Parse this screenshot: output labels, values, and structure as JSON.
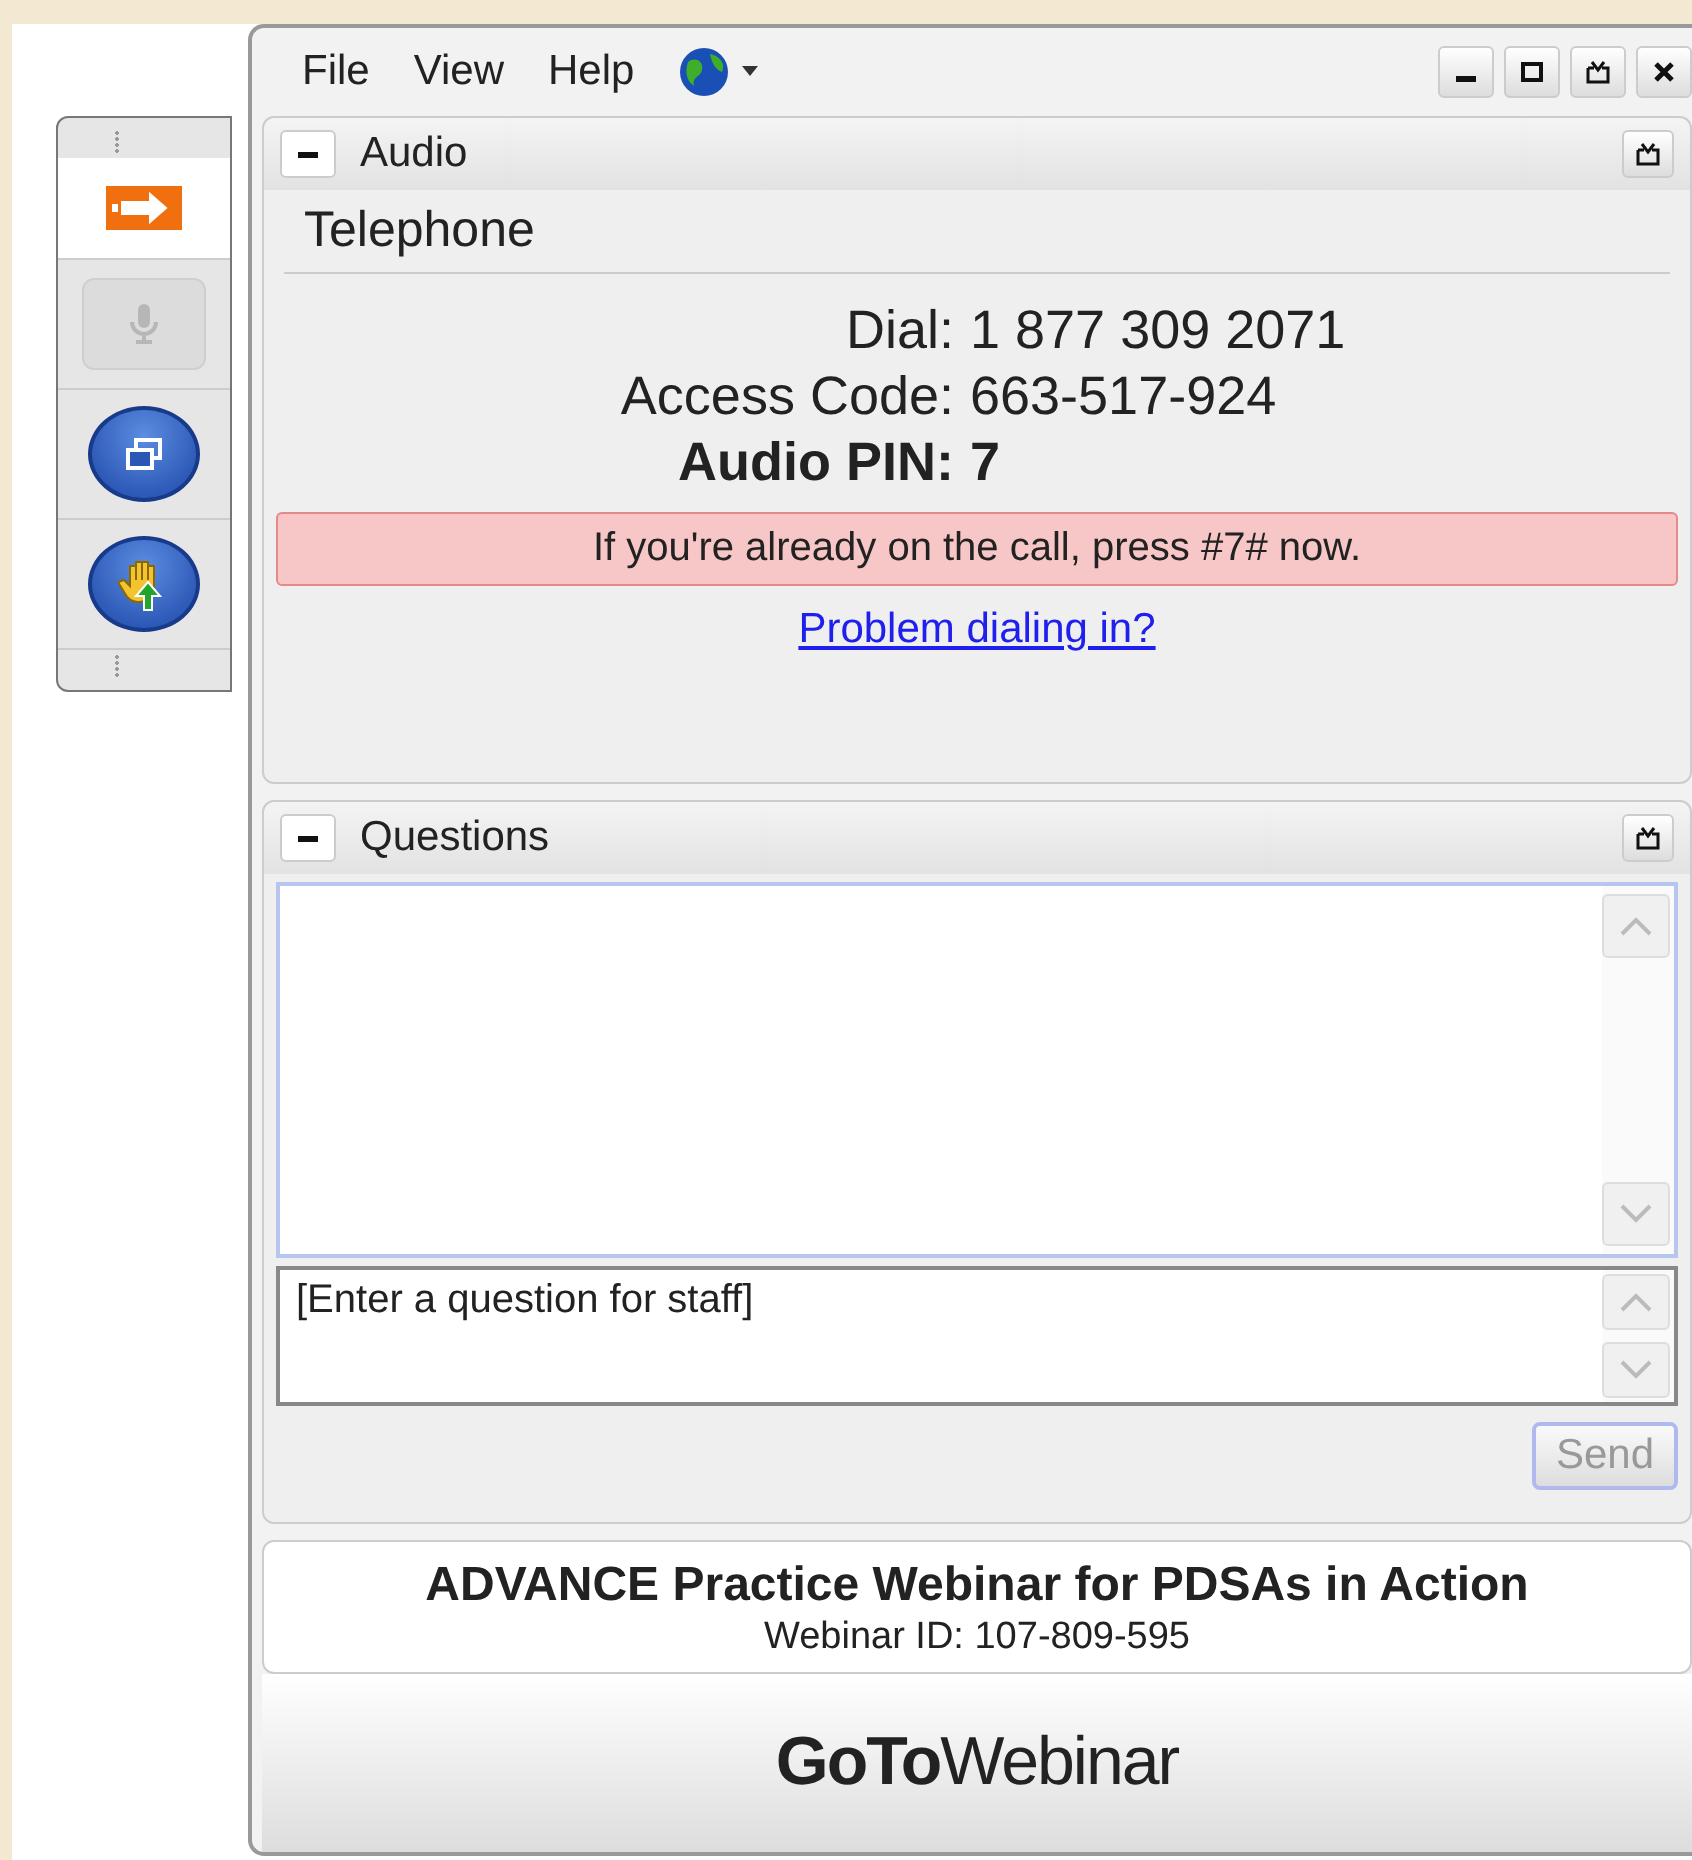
{
  "menu": {
    "items": [
      "File",
      "View",
      "Help"
    ]
  },
  "toolbar": {
    "tools": [
      {
        "kind": "arrow",
        "selected": true,
        "disabled": false
      },
      {
        "kind": "mic",
        "selected": false,
        "disabled": true
      },
      {
        "kind": "window",
        "selected": false,
        "disabled": false
      },
      {
        "kind": "hand",
        "selected": false,
        "disabled": false
      }
    ]
  },
  "audio": {
    "title": "Audio",
    "expanded": true,
    "mode": "Telephone",
    "details": [
      {
        "label": "Dial:",
        "value": "1 877 309 2071",
        "bold": false
      },
      {
        "label": "Access Code:",
        "value": "663-517-924",
        "bold": false
      },
      {
        "label": "Audio PIN:",
        "value": "7",
        "bold": true
      }
    ],
    "notice": "If you're already on the call, press #7# now.",
    "link": "Problem dialing in?"
  },
  "questions": {
    "title": "Questions",
    "expanded": true,
    "placeholder": "[Enter a question for staff]",
    "send": {
      "label": "Send",
      "disabled": true
    }
  },
  "webinar": {
    "title": "ADVANCE Practice Webinar for PDSAs in Action",
    "id": "Webinar ID: 107-809-595"
  },
  "logo": "**GoTo**Webinar"
}
